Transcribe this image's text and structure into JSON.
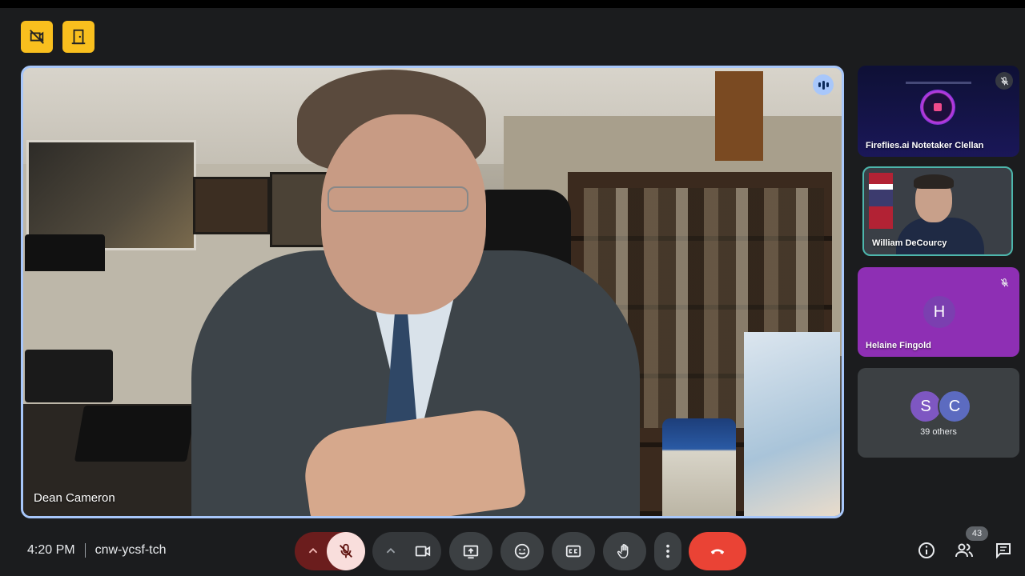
{
  "meeting": {
    "time": "4:20 PM",
    "code": "cnw-ycsf-tch"
  },
  "main_video": {
    "speaker_name": "Dean Cameron"
  },
  "side_tiles": {
    "notetaker": {
      "name": "Fireflies.ai Notetaker Clellan"
    },
    "participant_1": {
      "name": "William DeCourcy"
    },
    "participant_2": {
      "name": "Helaine Fingold",
      "initial": "H"
    },
    "others": {
      "initials": [
        "S",
        "C"
      ],
      "label": "39 others"
    }
  },
  "people_count": "43",
  "colors": {
    "accent_border": "#a8c7fa",
    "end_call": "#ea4335",
    "warning_yellow": "#f9bf1e",
    "helaine_tile": "#8e2fb4"
  },
  "icons": {
    "top_left_1": "no-recording-icon",
    "top_left_2": "door-icon",
    "controls": [
      "chevron-up-icon",
      "mic-off-icon",
      "chevron-up-icon",
      "camera-icon",
      "present-icon",
      "emoji-icon",
      "captions-icon",
      "raise-hand-icon",
      "more-vert-icon",
      "end-call-icon"
    ],
    "right": [
      "info-icon",
      "people-icon",
      "chat-icon"
    ]
  }
}
